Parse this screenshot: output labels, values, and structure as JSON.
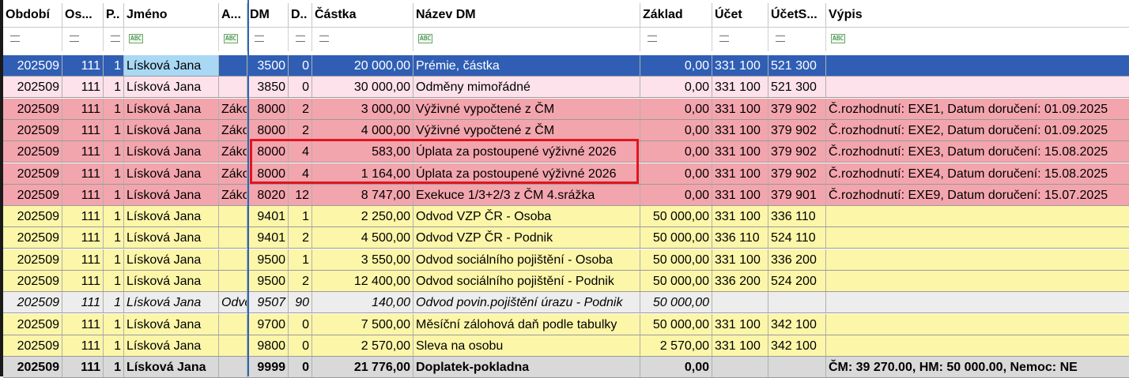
{
  "columns": [
    {
      "key": "obdobi",
      "label": "Období",
      "align": "left"
    },
    {
      "key": "os",
      "label": "Os...",
      "align": "left"
    },
    {
      "key": "p",
      "label": "P..",
      "align": "left"
    },
    {
      "key": "jmeno",
      "label": "Jméno",
      "align": "left"
    },
    {
      "key": "a",
      "label": "A...",
      "align": "left"
    },
    {
      "key": "dm",
      "label": "DM",
      "align": "left"
    },
    {
      "key": "d",
      "label": "D..",
      "align": "left"
    },
    {
      "key": "castka",
      "label": "Částka",
      "align": "left"
    },
    {
      "key": "nazev",
      "label": "Název DM",
      "align": "left"
    },
    {
      "key": "zaklad",
      "label": "Základ",
      "align": "left"
    },
    {
      "key": "ucet",
      "label": "Účet",
      "align": "left"
    },
    {
      "key": "ucets",
      "label": "ÚčetS...",
      "align": "left"
    },
    {
      "key": "vypis",
      "label": "Výpis",
      "align": "left"
    }
  ],
  "filters": [
    "eq",
    "eq",
    "eq",
    "abc",
    "abc",
    "eq",
    "eq",
    "eq",
    "abc",
    "eq",
    "eq",
    "eq",
    "abc"
  ],
  "rows": [
    {
      "style": "sel",
      "cells": [
        "202509",
        "111",
        "1",
        "Lísková Jana",
        "",
        "3500",
        "0",
        "20 000,00",
        "Prémie, částka",
        "0,00",
        "331 100",
        "521 300",
        ""
      ]
    },
    {
      "style": "pink",
      "cells": [
        "202509",
        "111",
        "1",
        "Lísková Jana",
        "",
        "3850",
        "0",
        "30 000,00",
        "Odměny mimořádné",
        "0,00",
        "331 100",
        "521 300",
        ""
      ]
    },
    {
      "style": "red",
      "cells": [
        "202509",
        "111",
        "1",
        "Lísková Jana",
        "Zákon",
        "8000",
        "2",
        "3 000,00",
        "Výživné vypočtené z ČM",
        "0,00",
        "331 100",
        "379 902",
        "Č.rozhodnutí: EXE1, Datum doručení: 01.09.2025"
      ]
    },
    {
      "style": "red",
      "cells": [
        "202509",
        "111",
        "1",
        "Lísková Jana",
        "Zákon",
        "8000",
        "2",
        "4 000,00",
        "Výživné vypočtené z ČM",
        "0,00",
        "331 100",
        "379 902",
        "Č.rozhodnutí: EXE2, Datum doručení: 01.09.2025"
      ]
    },
    {
      "style": "red",
      "cells": [
        "202509",
        "111",
        "1",
        "Lísková Jana",
        "Zákon",
        "8000",
        "4",
        "583,00",
        "Úplata za postoupené výživné 2026",
        "0,00",
        "331 100",
        "379 902",
        "Č.rozhodnutí: EXE3, Datum doručení: 15.08.2025"
      ]
    },
    {
      "style": "red",
      "cells": [
        "202509",
        "111",
        "1",
        "Lísková Jana",
        "Zákon",
        "8000",
        "4",
        "1 164,00",
        "Úplata za postoupené výživné 2026",
        "0,00",
        "331 100",
        "379 902",
        "Č.rozhodnutí: EXE4, Datum doručení: 15.08.2025"
      ]
    },
    {
      "style": "red",
      "cells": [
        "202509",
        "111",
        "1",
        "Lísková Jana",
        "Zákon",
        "8020",
        "12",
        "8 747,00",
        "Exekuce 1/3+2/3 z ČM 4.srážka",
        "0,00",
        "331 100",
        "379 901",
        "Č.rozhodnutí: EXE9, Datum doručení: 15.07.2025"
      ]
    },
    {
      "style": "yellow",
      "cells": [
        "202509",
        "111",
        "1",
        "Lísková Jana",
        "",
        "9401",
        "1",
        "2 250,00",
        "Odvod VZP ČR - Osoba",
        "50 000,00",
        "331 100",
        "336 110",
        ""
      ]
    },
    {
      "style": "yellow",
      "cells": [
        "202509",
        "111",
        "1",
        "Lísková Jana",
        "",
        "9401",
        "2",
        "4 500,00",
        "Odvod VZP ČR - Podnik",
        "50 000,00",
        "336 110",
        "524 110",
        ""
      ]
    },
    {
      "style": "yellow",
      "cells": [
        "202509",
        "111",
        "1",
        "Lísková Jana",
        "",
        "9500",
        "1",
        "3 550,00",
        "Odvod sociálního pojištění - Osoba",
        "50 000,00",
        "331 100",
        "336 200",
        ""
      ]
    },
    {
      "style": "yellow",
      "cells": [
        "202509",
        "111",
        "1",
        "Lísková Jana",
        "",
        "9500",
        "2",
        "12 400,00",
        "Odvod sociálního pojištění - Podnik",
        "50 000,00",
        "336 200",
        "524 200",
        ""
      ]
    },
    {
      "style": "grey",
      "cells": [
        "202509",
        "111",
        "1",
        "Lísková Jana",
        "Odvod",
        "9507",
        "90",
        "140,00",
        "Odvod povin.pojištění úrazu - Podnik",
        "50 000,00",
        "",
        "",
        ""
      ]
    },
    {
      "style": "yellow",
      "cells": [
        "202509",
        "111",
        "1",
        "Lísková Jana",
        "",
        "9700",
        "0",
        "7 500,00",
        "Měsíční zálohová daň podle tabulky",
        "50 000,00",
        "331 100",
        "342 100",
        ""
      ]
    },
    {
      "style": "yellow",
      "cells": [
        "202509",
        "111",
        "1",
        "Lísková Jana",
        "",
        "9800",
        "0",
        "2 570,00",
        "Sleva na osobu",
        "2 570,00",
        "331 100",
        "342 100",
        ""
      ]
    },
    {
      "style": "bold",
      "cells": [
        "202509",
        "111",
        "1",
        "Lísková Jana",
        "",
        "9999",
        "0",
        "21 776,00",
        "Doplatek-pokladna",
        "0,00",
        "",
        "",
        "ČM: 39 270.00, HM: 50 000.00, Nemoc:  NE"
      ]
    }
  ],
  "colors": {
    "selected": "#2f5eb4",
    "red": "#f3a5ad",
    "yellow": "#fcf6a9",
    "pink": "#fde2ec",
    "highlight": "#e3141f"
  },
  "icons": {
    "eq": "equals-filter-icon",
    "abc": "text-filter-icon"
  }
}
